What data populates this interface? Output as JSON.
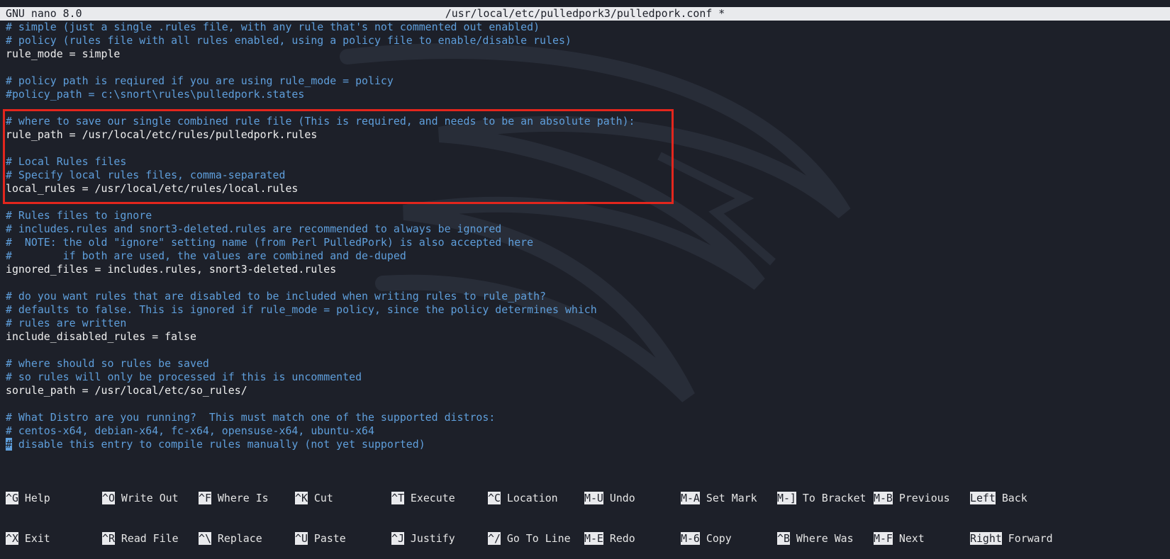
{
  "titlebar": {
    "app": "GNU nano 8.0",
    "file": "/usr/local/etc/pulledpork3/pulledpork.conf *"
  },
  "editor": {
    "lines": [
      {
        "type": "comment",
        "text": "# simple (just a single .rules file, with any rule that's not commented out enabled)"
      },
      {
        "type": "comment",
        "text": "# policy (rules file with all rules enabled, using a policy file to enable/disable rules)"
      },
      {
        "type": "code",
        "text": "rule_mode = simple"
      },
      {
        "type": "blank",
        "text": ""
      },
      {
        "type": "comment",
        "text": "# policy path is reqiured if you are using rule_mode = policy"
      },
      {
        "type": "comment",
        "text": "#policy_path = c:\\snort\\rules\\pulledpork.states"
      },
      {
        "type": "blank",
        "text": ""
      },
      {
        "type": "comment",
        "text": "# where to save our single combined rule file (This is required, and needs to be an absolute path):"
      },
      {
        "type": "code",
        "text": "rule_path = /usr/local/etc/rules/pulledpork.rules"
      },
      {
        "type": "blank",
        "text": ""
      },
      {
        "type": "comment",
        "text": "# Local Rules files"
      },
      {
        "type": "comment",
        "text": "# Specify local rules files, comma-separated"
      },
      {
        "type": "code",
        "text": "local_rules = /usr/local/etc/rules/local.rules"
      },
      {
        "type": "blank",
        "text": ""
      },
      {
        "type": "comment",
        "text": "# Rules files to ignore"
      },
      {
        "type": "comment",
        "text": "# includes.rules and snort3-deleted.rules are recommended to always be ignored"
      },
      {
        "type": "comment",
        "text": "#  NOTE: the old \"ignore\" setting name (from Perl PulledPork) is also accepted here"
      },
      {
        "type": "comment",
        "text": "#        if both are used, the values are combined and de-duped"
      },
      {
        "type": "code",
        "text": "ignored_files = includes.rules, snort3-deleted.rules"
      },
      {
        "type": "blank",
        "text": ""
      },
      {
        "type": "comment",
        "text": "# do you want rules that are disabled to be included when writing rules to rule_path?"
      },
      {
        "type": "comment",
        "text": "# defaults to false. This is ignored if rule_mode = policy, since the policy determines which"
      },
      {
        "type": "comment",
        "text": "# rules are written"
      },
      {
        "type": "code",
        "text": "include_disabled_rules = false"
      },
      {
        "type": "blank",
        "text": ""
      },
      {
        "type": "comment",
        "text": "# where should so rules be saved"
      },
      {
        "type": "comment",
        "text": "# so rules will only be processed if this is uncommented"
      },
      {
        "type": "code",
        "text": "sorule_path = /usr/local/etc/so_rules/"
      },
      {
        "type": "blank",
        "text": ""
      },
      {
        "type": "comment",
        "text": "# What Distro are you running?  This must match one of the supported distros:"
      },
      {
        "type": "comment",
        "text": "# centos-x64, debian-x64, fc-x64, opensuse-x64, ubuntu-x64"
      },
      {
        "type": "cursorline",
        "cursor": "#",
        "text": " disable this entry to compile rules manually (not yet supported)"
      }
    ]
  },
  "shortcuts": {
    "row1": [
      {
        "key": "^G",
        "label": "Help"
      },
      {
        "key": "^O",
        "label": "Write Out"
      },
      {
        "key": "^F",
        "label": "Where Is"
      },
      {
        "key": "^K",
        "label": "Cut"
      },
      {
        "key": "^T",
        "label": "Execute"
      },
      {
        "key": "^C",
        "label": "Location"
      },
      {
        "key": "M-U",
        "label": "Undo"
      },
      {
        "key": "M-A",
        "label": "Set Mark"
      },
      {
        "key": "M-]",
        "label": "To Bracket"
      },
      {
        "key": "M-B",
        "label": "Previous"
      },
      {
        "key": "Left",
        "label": "Back"
      }
    ],
    "row2": [
      {
        "key": "^X",
        "label": "Exit"
      },
      {
        "key": "^R",
        "label": "Read File"
      },
      {
        "key": "^\\",
        "label": "Replace"
      },
      {
        "key": "^U",
        "label": "Paste"
      },
      {
        "key": "^J",
        "label": "Justify"
      },
      {
        "key": "^/",
        "label": "Go To Line"
      },
      {
        "key": "M-E",
        "label": "Redo"
      },
      {
        "key": "M-6",
        "label": "Copy"
      },
      {
        "key": "^B",
        "label": "Where Was"
      },
      {
        "key": "M-F",
        "label": "Next"
      },
      {
        "key": "Right",
        "label": "Forward"
      }
    ]
  },
  "colors": {
    "background": "#1d2029",
    "comment": "#5f9fdc",
    "highlight_box": "#e3261d"
  }
}
